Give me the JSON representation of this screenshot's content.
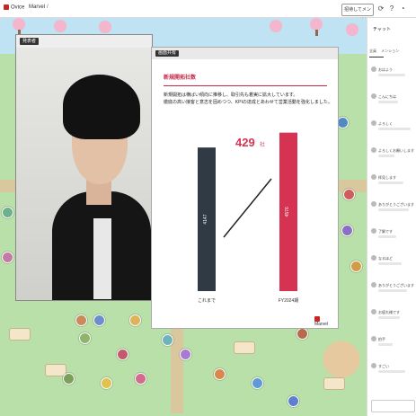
{
  "app": {
    "brand": "Ovice",
    "space_name": "Marvel",
    "separator": "/",
    "invite_label": "招待してメンバーを追加",
    "top_icons": [
      "sync-icon",
      "help-icon",
      "bell-icon"
    ]
  },
  "video": {
    "tag_label": "発表者"
  },
  "slide_window": {
    "tag_label": "画面共有",
    "slide": {
      "title": "新規開拓社数",
      "lines": [
        "新規開拓は横ばい傾向に推移し、取引先も着実に拡大しています。",
        "徹底の高い接客と意志を固めつつ、KPIの達成とあわせて営業活動を強化しました。"
      ],
      "logo_text": "Marvel"
    }
  },
  "chart_data": {
    "type": "bar",
    "categories": [
      "これまで",
      "FY2024期"
    ],
    "values": [
      4147,
      4576
    ],
    "bar_labels": [
      "4147",
      "4576"
    ],
    "bar_colors": [
      "#2f3a45",
      "#d63352"
    ],
    "delta_label": "429",
    "delta_unit": "社",
    "delta_color": "#d63352",
    "ylim": [
      0,
      4800
    ]
  },
  "chat": {
    "title": "チャット",
    "tabs": [
      "全員",
      "メンション"
    ],
    "messages": [
      {
        "text": "おはよう"
      },
      {
        "text": "こんにちは"
      },
      {
        "text": "よろしく"
      },
      {
        "text": "よろしくお願いします"
      },
      {
        "text": "拝見します"
      },
      {
        "text": "ありがとうございます"
      },
      {
        "text": "了解です"
      },
      {
        "text": "なるほど"
      },
      {
        "text": "ありがとうございます"
      },
      {
        "text": "お疲れ様です"
      },
      {
        "text": "拍手"
      },
      {
        "text": "すごい"
      }
    ]
  }
}
